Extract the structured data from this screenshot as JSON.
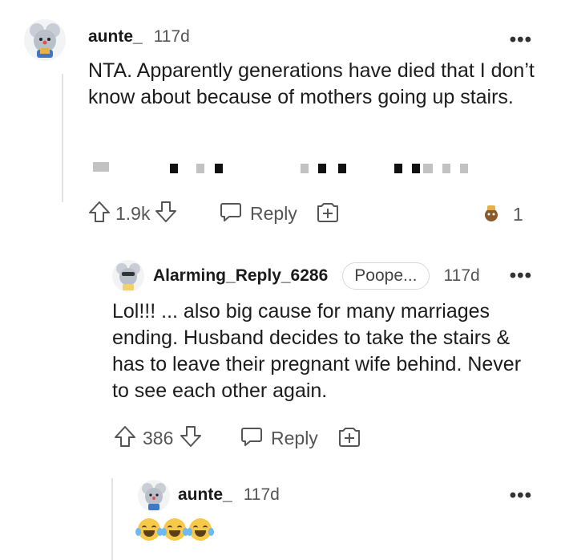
{
  "comment1": {
    "author": "aunte_",
    "age": "117d",
    "more": "•••",
    "text": "NTA. Apparently generations have died that I don’t know about because of mothers going up stairs.",
    "edit_partial": "Edit: th",
    "votes": "1.9k",
    "reply": "Reply",
    "award_count": "1"
  },
  "comment2": {
    "author": "Alarming_Reply_6286",
    "flair": "Poope...",
    "age": "117d",
    "more": "•••",
    "text": "Lol!!! ... also big cause for many marriages ending. Husband decides to take the stairs & has to leave their pregnant wife behind. Never to see each other again.",
    "votes": "386",
    "reply": "Reply"
  },
  "comment3": {
    "author": "aunte_",
    "age": "117d",
    "more": "•••"
  },
  "colors": {
    "text": "#1c1c1c",
    "muted": "#555555",
    "line": "#e3e3e3"
  }
}
